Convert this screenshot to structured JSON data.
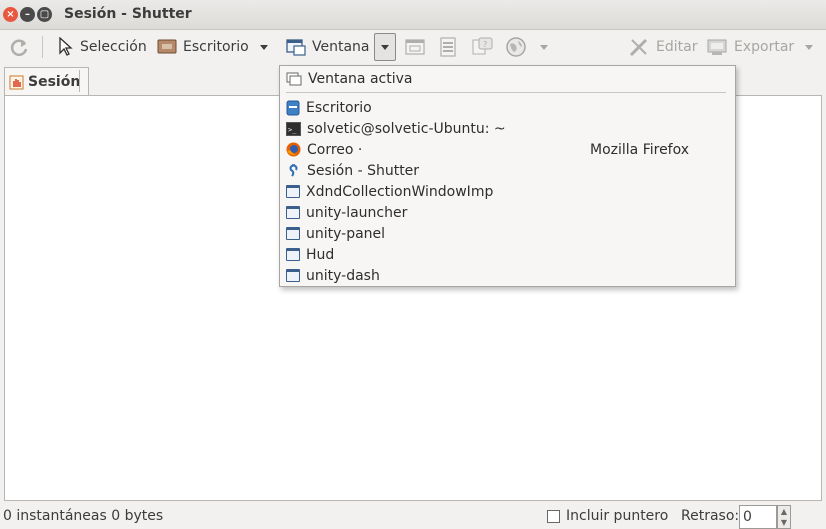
{
  "window": {
    "title": "Sesión - Shutter"
  },
  "toolbar": {
    "selection_label": "Selección",
    "desktop_label": "Escritorio",
    "window_label": "Ventana",
    "edit_label": "Editar",
    "export_label": "Exportar"
  },
  "tabs": [
    {
      "label": "Sesión"
    }
  ],
  "window_menu": {
    "items": [
      {
        "label": "Ventana activa",
        "icon": "window-active-icon"
      },
      {
        "label": "Escritorio",
        "icon": "desktop-icon"
      },
      {
        "label": "solvetic@solvetic-Ubuntu: ~",
        "icon": "terminal-icon"
      },
      {
        "label": "Correo ·",
        "extra": "Mozilla Firefox",
        "icon": "firefox-icon"
      },
      {
        "label": "Sesión - Shutter",
        "icon": "shutter-icon"
      },
      {
        "label": "XdndCollectionWindowImp",
        "icon": "window-icon"
      },
      {
        "label": "unity-launcher",
        "icon": "window-icon"
      },
      {
        "label": "unity-panel",
        "icon": "window-icon"
      },
      {
        "label": "Hud",
        "icon": "window-icon"
      },
      {
        "label": "unity-dash",
        "icon": "window-icon"
      }
    ]
  },
  "statusbar": {
    "summary": "0 instantáneas  0 bytes",
    "include_pointer_label": "Incluir puntero",
    "include_pointer_checked": false,
    "delay_label": "Retraso:",
    "delay_value": "0"
  },
  "colors": {
    "close_button": "#e8573f",
    "window_bg": "#f2f1f0",
    "content_bg": "#ffffff",
    "icon_blue": "#3a5f8c"
  }
}
